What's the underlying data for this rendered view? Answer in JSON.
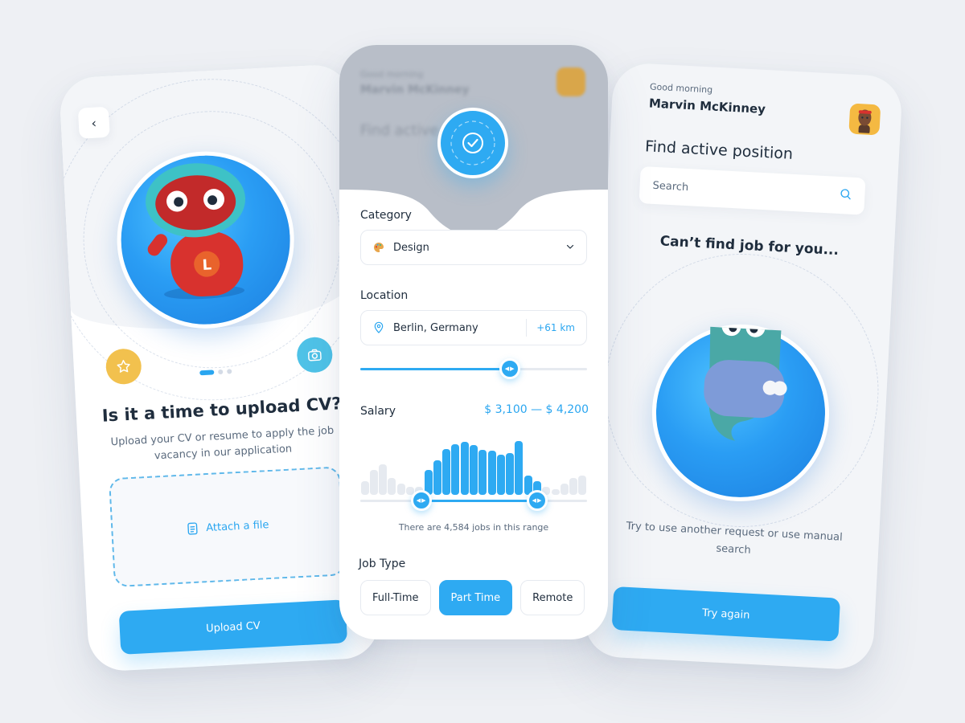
{
  "colors": {
    "accent": "#2eaaf2",
    "background": "#eef0f4",
    "star_fab": "#f2c14e",
    "camera_fab": "#4fc3e8",
    "heading": "#1f2d3d",
    "muted": "#5a6a7d"
  },
  "upload_screen": {
    "back_icon": "chevron-left-icon",
    "star_icon": "star-icon",
    "camera_icon": "camera-icon",
    "pager": {
      "count": 3,
      "active": 1
    },
    "title": "Is it a time to upload CV?",
    "description": "Upload your CV or resume to apply the job vacancy in our application",
    "attach_label": "Attach a file",
    "attach_icon": "file-icon",
    "button_label": "Upload CV"
  },
  "filter_screen": {
    "status_icon": "check-circle-icon",
    "category": {
      "label": "Category",
      "value": "Design",
      "icon": "palette-icon"
    },
    "location": {
      "label": "Location",
      "value": "Berlin, Germany",
      "icon": "location-pin-icon",
      "radius": "+61 km",
      "slider_fraction": 0.66
    },
    "salary": {
      "label": "Salary",
      "range_text": "$ 3,100 — $ 4,200",
      "range_start_fraction": 0.27,
      "range_end_fraction": 0.78,
      "histogram": [
        0.25,
        0.45,
        0.55,
        0.3,
        0.2,
        0.15,
        0.15,
        0.45,
        0.62,
        0.82,
        0.9,
        0.95,
        0.88,
        0.8,
        0.78,
        0.72,
        0.75,
        0.96,
        0.35,
        0.25,
        0.15,
        0.1,
        0.2,
        0.3,
        0.35
      ],
      "jobs_note": "There are 4,584 jobs in this range"
    },
    "job_type": {
      "label": "Job Type",
      "options": [
        "Full-Time",
        "Part Time",
        "Remote"
      ],
      "selected": "Part Time"
    }
  },
  "empty_screen": {
    "greeting": "Good morning",
    "user_name": "Marvin McKinney",
    "heading": "Find active position",
    "search_placeholder": "Search",
    "search_icon": "search-icon",
    "title": "Can’t find job for you...",
    "description": "Try to use another request or use manual search",
    "button_label": "Try again"
  }
}
